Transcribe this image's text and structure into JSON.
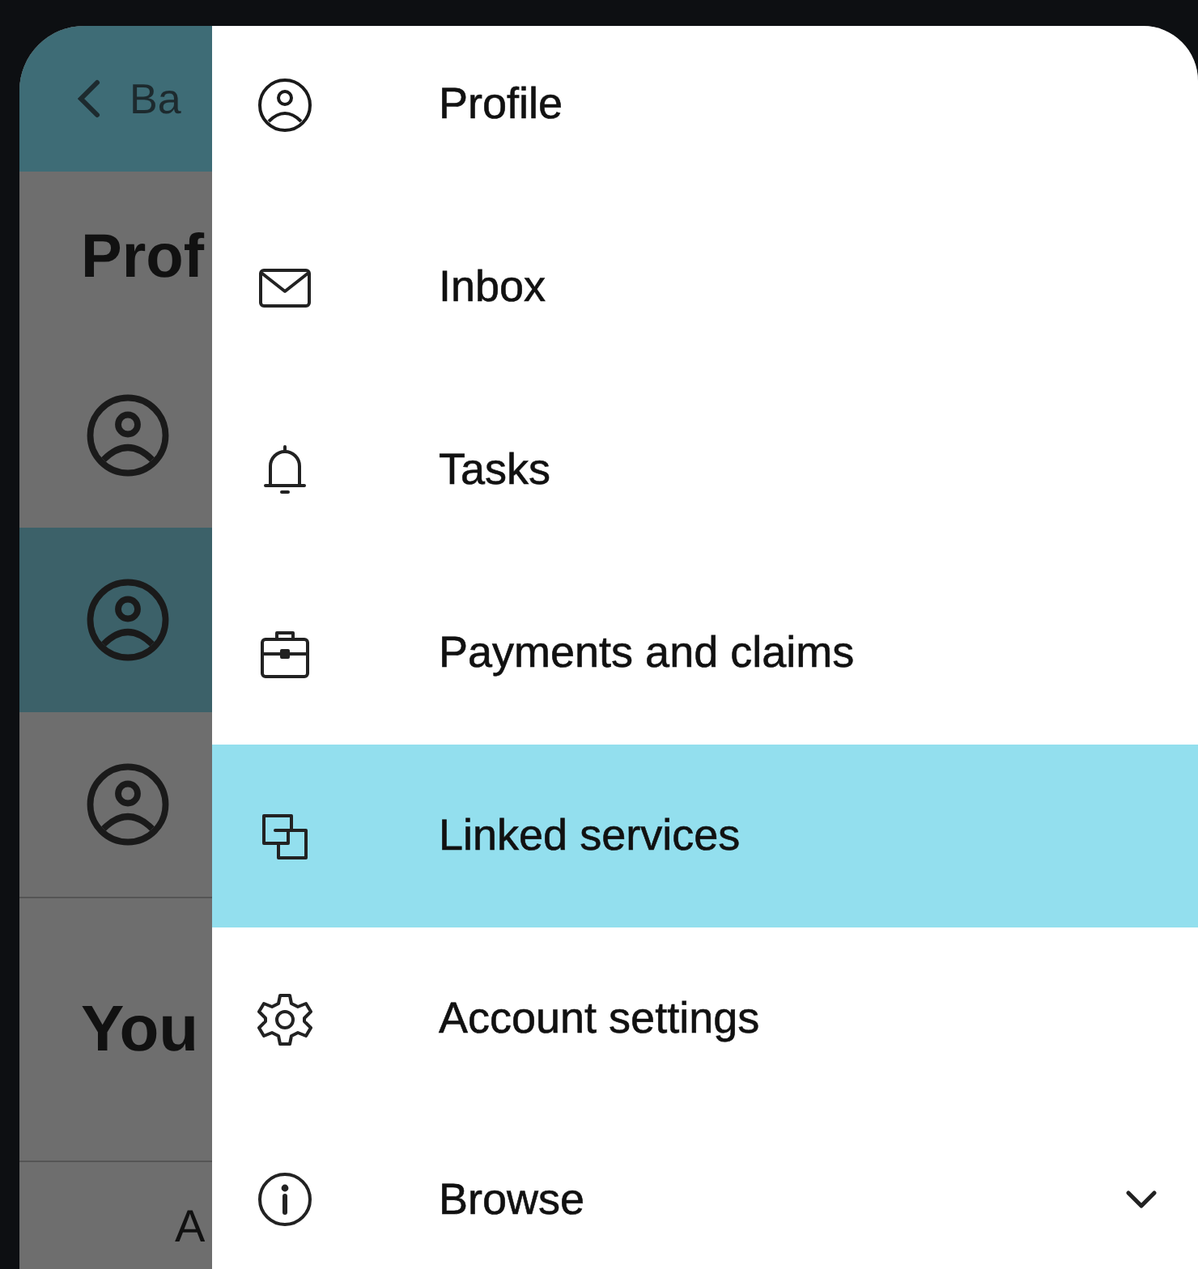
{
  "background_screen": {
    "back_button": {
      "label": "Ba"
    },
    "heading": "Prof",
    "rows": [
      {
        "selected": false
      },
      {
        "selected": true
      },
      {
        "selected": false
      }
    ],
    "section_heading": "You",
    "list_item": "A"
  },
  "drawer": {
    "items": [
      {
        "label": "Profile",
        "selected": false
      },
      {
        "label": "Inbox",
        "selected": false
      },
      {
        "label": "Tasks",
        "selected": false
      },
      {
        "label": "Payments and claims",
        "selected": false
      },
      {
        "label": "Linked services",
        "selected": true
      },
      {
        "label": "Account settings",
        "selected": false
      },
      {
        "label": "Browse",
        "selected": false,
        "expanded": false
      }
    ]
  }
}
